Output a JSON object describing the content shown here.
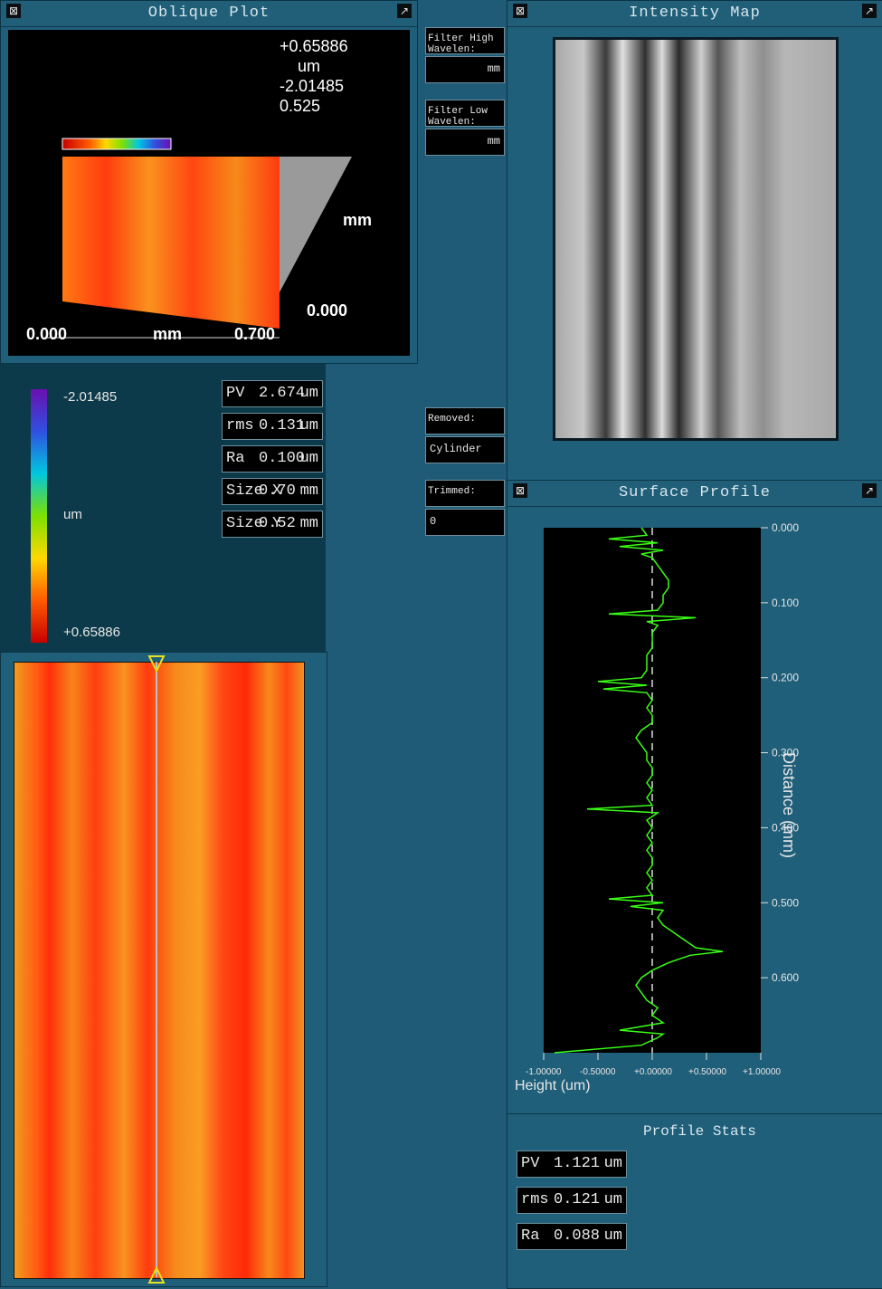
{
  "colors": {
    "panel": "#1f5f7a",
    "stat_bg": "#000000",
    "profile_line": "#39ff14"
  },
  "icons": {
    "maximize": "maximize-icon",
    "pin": "pin-icon"
  },
  "map_legend": {
    "max": "+0.65886",
    "unit": "um",
    "min": "-2.01485"
  },
  "area_stats": [
    {
      "label": "PV",
      "value": "2.674",
      "unit": "um"
    },
    {
      "label": "rms",
      "value": "0.131",
      "unit": "um"
    },
    {
      "label": "Ra",
      "value": "0.100",
      "unit": "um"
    },
    {
      "label": "Size X",
      "value": "0.70",
      "unit": "mm"
    },
    {
      "label": "Size Y",
      "value": "0.52",
      "unit": "mm"
    }
  ],
  "oblique": {
    "title": "Oblique Plot",
    "legend_max": "+0.65886",
    "legend_unit": "um",
    "legend_min": "-2.01485",
    "legend_extra": "0.525",
    "x_start": "0.000",
    "x_end": "0.700",
    "x_unit": "mm",
    "y_start": "0.000",
    "y_unit": "mm"
  },
  "filter": {
    "removed_label": "Removed:",
    "removed_value": "Cylinder",
    "trimmed_label": "Trimmed:",
    "trimmed_value": "0",
    "high_label": "Filter High Wavelen:",
    "high_unit": "mm",
    "low_label": "Filter Low  Wavelen:",
    "low_unit": "mm"
  },
  "profile": {
    "title": "Surface Profile"
  },
  "profile_stats": {
    "title": "Profile Stats",
    "items": [
      {
        "label": "PV",
        "value": "1.121",
        "unit": "um"
      },
      {
        "label": "rms",
        "value": "0.121",
        "unit": "um"
      },
      {
        "label": "Ra",
        "value": "0.088",
        "unit": "um"
      }
    ]
  },
  "intensity": {
    "title": "Intensity Map"
  },
  "chart_data": {
    "type": "line",
    "xlabel": "Distance (mm)",
    "ylabel": "Height (um)",
    "xlim": [
      0,
      0.7
    ],
    "ylim": [
      -1.0,
      1.0
    ],
    "x_ticks": [
      "0.000",
      "0.100",
      "0.200",
      "0.300",
      "0.400",
      "0.500",
      "0.600"
    ],
    "y_ticks": [
      "+1.00000",
      "+0.50000",
      "+0.00000",
      "-0.50000",
      "-1.00000"
    ],
    "reference_line": 0.0,
    "series": [
      {
        "x": [
          0.0,
          0.01,
          0.015,
          0.02,
          0.025,
          0.03,
          0.035,
          0.04,
          0.05,
          0.06,
          0.07,
          0.08,
          0.09,
          0.1,
          0.11,
          0.115,
          0.12,
          0.125,
          0.13,
          0.14,
          0.15,
          0.16,
          0.17,
          0.18,
          0.19,
          0.2,
          0.205,
          0.21,
          0.215,
          0.22,
          0.23,
          0.24,
          0.25,
          0.26,
          0.27,
          0.28,
          0.29,
          0.3,
          0.31,
          0.32,
          0.33,
          0.34,
          0.35,
          0.36,
          0.37,
          0.375,
          0.38,
          0.385,
          0.39,
          0.4,
          0.41,
          0.42,
          0.43,
          0.44,
          0.45,
          0.46,
          0.47,
          0.48,
          0.49,
          0.495,
          0.5,
          0.505,
          0.51,
          0.52,
          0.53,
          0.54,
          0.55,
          0.56,
          0.565,
          0.57,
          0.575,
          0.58,
          0.59,
          0.6,
          0.61,
          0.62,
          0.63,
          0.64,
          0.65,
          0.66,
          0.67,
          0.675,
          0.68,
          0.69,
          0.7
        ],
        "y": [
          -0.1,
          -0.05,
          -0.4,
          0.05,
          -0.3,
          0.1,
          -0.1,
          0.0,
          0.05,
          0.1,
          0.15,
          0.15,
          0.1,
          0.1,
          0.05,
          -0.4,
          0.4,
          -0.05,
          0.05,
          0.0,
          0.0,
          0.0,
          -0.05,
          -0.05,
          -0.05,
          -0.1,
          -0.5,
          -0.05,
          -0.45,
          -0.05,
          0.0,
          -0.05,
          0.0,
          0.0,
          -0.1,
          -0.15,
          -0.1,
          -0.05,
          -0.05,
          0.0,
          0.0,
          -0.05,
          0.0,
          -0.05,
          0.0,
          -0.6,
          0.05,
          0.0,
          -0.05,
          0.0,
          -0.05,
          0.0,
          -0.05,
          0.0,
          0.0,
          -0.05,
          0.0,
          -0.05,
          0.0,
          -0.4,
          0.1,
          -0.2,
          0.1,
          0.05,
          0.1,
          0.2,
          0.3,
          0.4,
          0.65,
          0.35,
          0.25,
          0.15,
          0.0,
          -0.1,
          -0.15,
          -0.1,
          -0.05,
          0.05,
          0.0,
          0.1,
          -0.3,
          0.1,
          0.05,
          -0.1,
          -0.9
        ]
      }
    ]
  }
}
